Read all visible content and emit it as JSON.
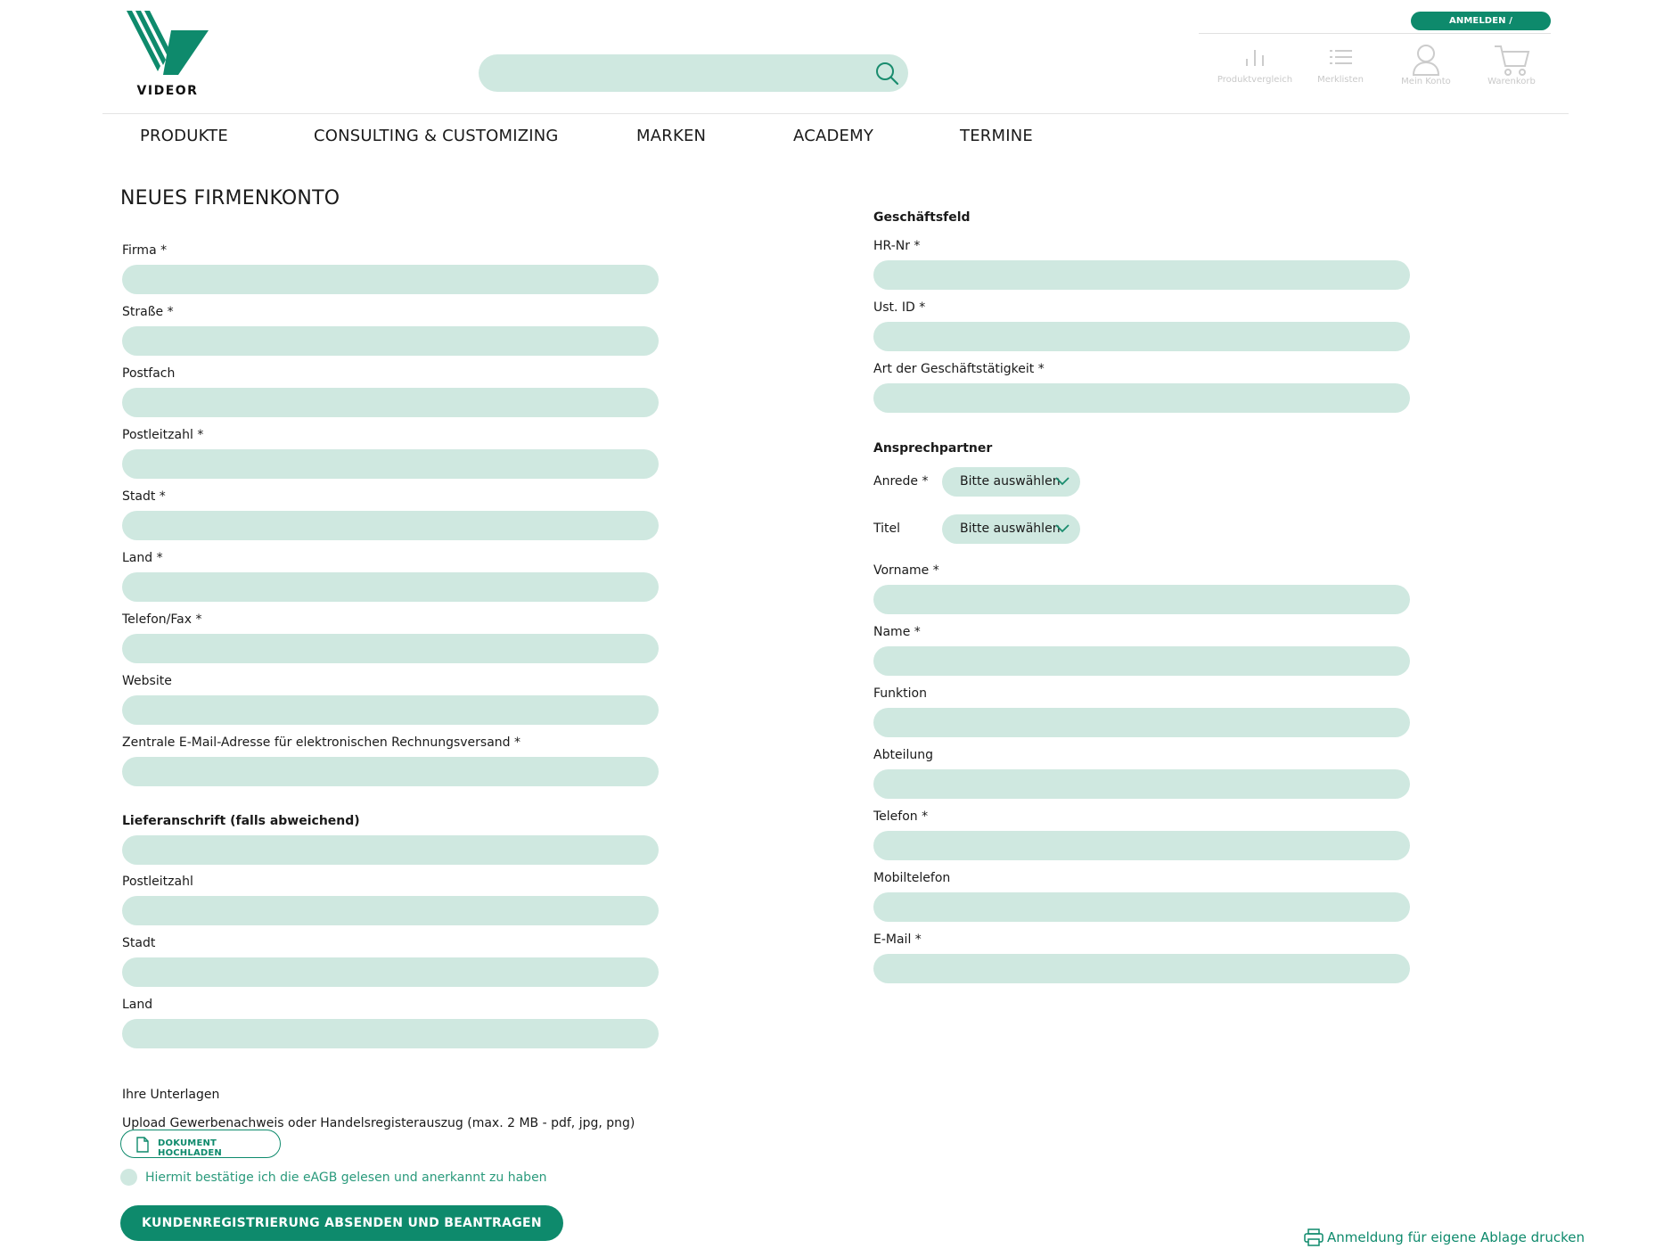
{
  "brand": {
    "logo_text": "VIDEOR",
    "accent": "#0e8a6c",
    "field_bg": "#cfe8e0"
  },
  "header": {
    "search": {
      "placeholder": "",
      "icon": "search-icon"
    },
    "login_label": "ANMELDEN / REGISTRIEREN",
    "tools": [
      {
        "label": "Produktvergleich",
        "icon": "compare-chart-icon"
      },
      {
        "label": "Merklisten",
        "icon": "list-icon"
      },
      {
        "label": "Mein Konto",
        "icon": "user-icon"
      },
      {
        "label": "Warenkorb",
        "icon": "cart-icon"
      }
    ]
  },
  "nav": {
    "items": [
      "PRODUKTE",
      "CONSULTING & CUSTOMIZING",
      "MARKEN",
      "ACADEMY",
      "TERMINE"
    ]
  },
  "form": {
    "title": "NEUES FIRMENKONTO",
    "left_fields": [
      {
        "label": "Firma *",
        "value": ""
      },
      {
        "label": "Straße *",
        "value": ""
      },
      {
        "label": "Postfach",
        "value": ""
      },
      {
        "label": "Postleitzahl *",
        "value": ""
      },
      {
        "label": "Stadt *",
        "value": ""
      },
      {
        "label": "Land *",
        "value": ""
      },
      {
        "label": "Telefon/Fax *",
        "value": ""
      },
      {
        "label": "Website",
        "value": ""
      },
      {
        "label": "Zentrale E-Mail-Adresse für elektronischen Rechnungsversand *",
        "value": ""
      }
    ],
    "delivery": {
      "title": "Lieferanschrift (falls abweichend)",
      "fields": [
        {
          "label": "Postleitzahl",
          "value": ""
        },
        {
          "label": "Stadt",
          "value": ""
        },
        {
          "label": "Land",
          "value": ""
        }
      ]
    },
    "business": {
      "title": "Geschäftsfeld",
      "fields": [
        {
          "label": "HR-Nr *",
          "value": ""
        },
        {
          "label": "Ust. ID *",
          "value": ""
        },
        {
          "label": "Art der Geschäftstätigkeit *",
          "value": ""
        }
      ]
    },
    "contact": {
      "title": "Ansprechpartner",
      "anrede": {
        "label": "Anrede *",
        "selected": "Bitte auswählen"
      },
      "titel": {
        "label": "Titel",
        "selected": "Bitte auswählen"
      },
      "fields": [
        {
          "label": "Vorname *",
          "value": ""
        },
        {
          "label": "Name *",
          "value": ""
        },
        {
          "label": "Funktion",
          "value": ""
        },
        {
          "label": "Abteilung",
          "value": ""
        },
        {
          "label": "Telefon *",
          "value": ""
        },
        {
          "label": "Mobiltelefon",
          "value": ""
        },
        {
          "label": "E-Mail *",
          "value": ""
        }
      ]
    },
    "documents": {
      "title": "Ihre Unterlagen",
      "hint": "Upload Gewerbenachweis oder Handelsregisterauszug (max. 2 MB - pdf, jpg, png)",
      "upload_label": "DOKUMENT HOCHLADEN"
    },
    "agb_label": "Hiermit bestätige ich die eAGB gelesen und anerkannt zu haben",
    "submit_label": "KUNDENREGISTRIERUNG ABSENDEN UND BEANTRAGEN",
    "print_label": "Anmeldung für eigene Ablage drucken"
  }
}
